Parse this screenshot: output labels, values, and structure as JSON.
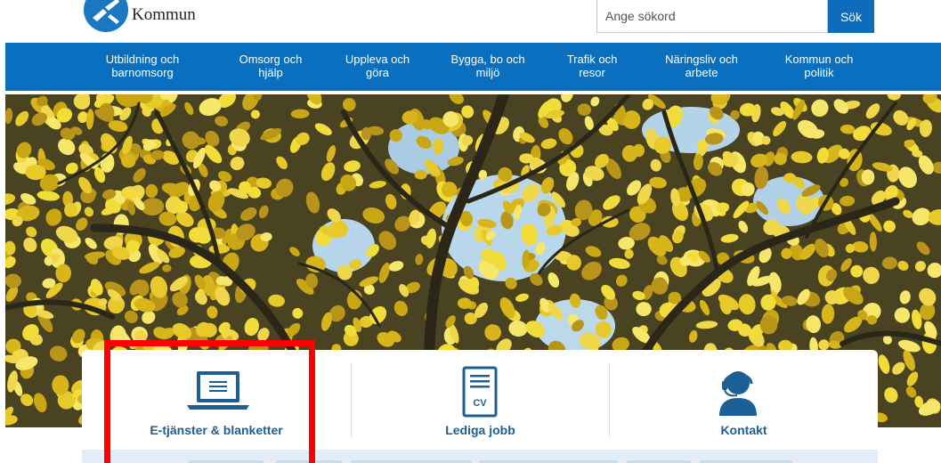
{
  "header": {
    "logo_text": "Kommun",
    "search_placeholder": "Ange sökord",
    "search_button": "Sök"
  },
  "nav": {
    "items": [
      {
        "line1": "Utbildning och",
        "line2": "barnomsorg"
      },
      {
        "line1": "Omsorg och",
        "line2": "hjälp"
      },
      {
        "line1": "Uppleva och",
        "line2": "göra"
      },
      {
        "line1": "Bygga, bo och",
        "line2": "miljö"
      },
      {
        "line1": "Trafik och",
        "line2": "resor"
      },
      {
        "line1": "Näringsliv och",
        "line2": "arbete"
      },
      {
        "line1": "Kommun och",
        "line2": "politik"
      }
    ]
  },
  "quick_links": [
    {
      "label": "E-tjänster & blanketter",
      "icon": "laptop-icon"
    },
    {
      "label": "Lediga jobb",
      "icon": "cv-document-icon",
      "icon_text": "CV"
    },
    {
      "label": "Kontakt",
      "icon": "headset-support-icon"
    }
  ],
  "colors": {
    "brand_blue": "#0b6fc0",
    "link_text": "#1c5f97",
    "highlight": "#ff0000"
  }
}
